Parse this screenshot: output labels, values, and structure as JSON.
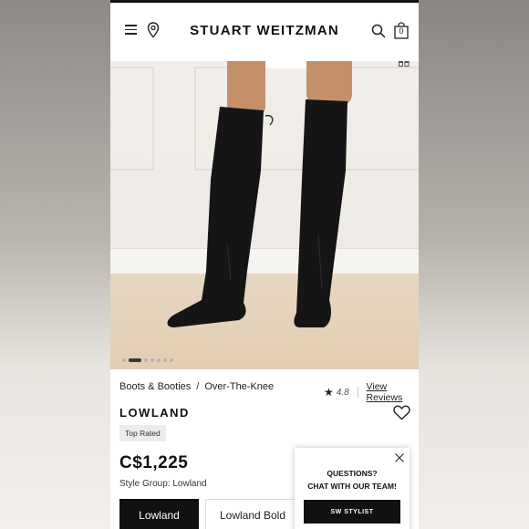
{
  "header": {
    "brand": "STUART WEITZMAN",
    "bag_count": "0"
  },
  "gallery": {
    "dot_count": 7,
    "active_index": 1
  },
  "breadcrumb": {
    "items": [
      "Boots & Booties",
      "Over-The-Knee"
    ],
    "separator": "/"
  },
  "rating": {
    "value": "4.8",
    "reviews_link": "View Reviews"
  },
  "product": {
    "name": "LOWLAND",
    "badge": "Top Rated",
    "price": "C$1,225",
    "style_group": "Style Group: Lowland"
  },
  "style_options": [
    {
      "label": "Lowland",
      "selected": true
    },
    {
      "label": "Lowland Bold",
      "selected": false
    }
  ],
  "chat": {
    "line1": "QUESTIONS?",
    "line2": "CHAT WITH OUR TEAM!",
    "button": "SW STYLIST"
  },
  "colors": {
    "accent": "#111111",
    "page_bg": "#ffffff",
    "badge_bg": "#ececec"
  }
}
